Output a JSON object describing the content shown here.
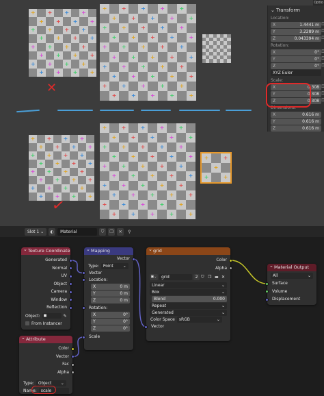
{
  "viewport": {
    "options_tab": "Optio",
    "annotation_x": "✕",
    "annotation_check": "✓"
  },
  "npanel": {
    "title": "Transform",
    "location_label": "Location:",
    "location": [
      {
        "axis": "X",
        "value": "1.4441 m"
      },
      {
        "axis": "Y",
        "value": "3.2289 m"
      },
      {
        "axis": "Z",
        "value": "0.043394 m"
      }
    ],
    "rotation_label": "Rotation:",
    "rotation": [
      {
        "axis": "X",
        "value": "0°"
      },
      {
        "axis": "Y",
        "value": "0°"
      },
      {
        "axis": "Z",
        "value": "0°"
      }
    ],
    "rotation_mode": "XYZ Euler",
    "scale_label": "Scale:",
    "scale": [
      {
        "axis": "X",
        "value": "0.308"
      },
      {
        "axis": "Y",
        "value": "0.308"
      },
      {
        "axis": "Z",
        "value": "0.308"
      }
    ],
    "dimensions_label": "Dimensions:",
    "dimensions": [
      {
        "axis": "X",
        "value": "0.616 m"
      },
      {
        "axis": "Y",
        "value": "0.616 m"
      },
      {
        "axis": "Z",
        "value": "0.616 m"
      }
    ]
  },
  "node_header": {
    "slot": "Slot 1",
    "material": "Material"
  },
  "nodes": {
    "texcoord": {
      "title": "Texture Coordinate",
      "outputs": [
        "Generated",
        "Normal",
        "UV",
        "Object",
        "Camera",
        "Window",
        "Reflection"
      ],
      "object_label": "Object:",
      "from_instancer": "From Instancer"
    },
    "mapping": {
      "title": "Mapping",
      "output": "Vector",
      "type_label": "Type:",
      "type_value": "Point",
      "vector_in": "Vector",
      "location_label": "Location:",
      "location": [
        {
          "axis": "X",
          "value": "0 m"
        },
        {
          "axis": "Y",
          "value": "0 m"
        },
        {
          "axis": "Z",
          "value": "0 m"
        }
      ],
      "rotation_label": "Rotation:",
      "rotation": [
        {
          "axis": "X",
          "value": "0°"
        },
        {
          "axis": "Y",
          "value": "0°"
        },
        {
          "axis": "Z",
          "value": "0°"
        }
      ],
      "scale_in": "Scale"
    },
    "grid": {
      "title": "grid",
      "outputs": [
        "Color",
        "Alpha"
      ],
      "image_name": "grid",
      "users": "2",
      "interpolation": "Linear",
      "projection": "Box",
      "blend_label": "Blend",
      "blend_value": "0.000",
      "extension": "Repeat",
      "source": "Generated",
      "colorspace_label": "Color Space",
      "colorspace_value": "sRGB",
      "vector_in": "Vector"
    },
    "attribute": {
      "title": "Attribute",
      "outputs": [
        "Color",
        "Vector",
        "Fac",
        "Alpha"
      ],
      "type_label": "Type:",
      "type_value": "Object",
      "name_label": "Name:",
      "name_value": "scale"
    },
    "output": {
      "title": "Material Output",
      "target": "All",
      "inputs": [
        "Surface",
        "Volume",
        "Displacement"
      ]
    }
  },
  "colors": {
    "checker_light": "#c9c9c9",
    "checker_dark": "#8a8a8a",
    "selection": "#e89a2c",
    "annotation_red": "#e02a2a",
    "wire_purple": "#6363c7",
    "wire_yellow": "#c7c729",
    "wire_green": "#63c763"
  }
}
